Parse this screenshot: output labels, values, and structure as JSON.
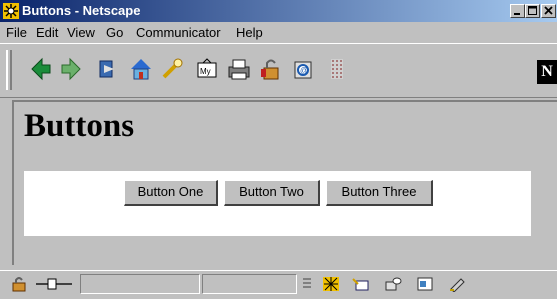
{
  "window": {
    "title": "Buttons - Netscape",
    "icon": "netscape-icon"
  },
  "menu": {
    "items": [
      {
        "label": "File"
      },
      {
        "label": "Edit"
      },
      {
        "label": "View"
      },
      {
        "label": "Go"
      },
      {
        "label": "Communicator"
      },
      {
        "label": "Help"
      }
    ]
  },
  "toolbar": {
    "buttons": [
      {
        "icon": "back-icon"
      },
      {
        "icon": "forward-icon"
      },
      {
        "icon": "reload-icon"
      },
      {
        "icon": "home-icon"
      },
      {
        "icon": "search-icon"
      },
      {
        "icon": "my-netscape-icon"
      },
      {
        "icon": "print-icon"
      },
      {
        "icon": "security-icon"
      },
      {
        "icon": "shop-icon"
      },
      {
        "icon": "stop-icon"
      }
    ],
    "logo": "N"
  },
  "page": {
    "heading": "Buttons",
    "buttons": [
      {
        "label": "Button One"
      },
      {
        "label": "Button Two"
      },
      {
        "label": "Button Three"
      }
    ]
  },
  "colors": {
    "titlebar_start": "#0a246a",
    "titlebar_end": "#a6caf0",
    "chrome": "#c0c0c0"
  }
}
